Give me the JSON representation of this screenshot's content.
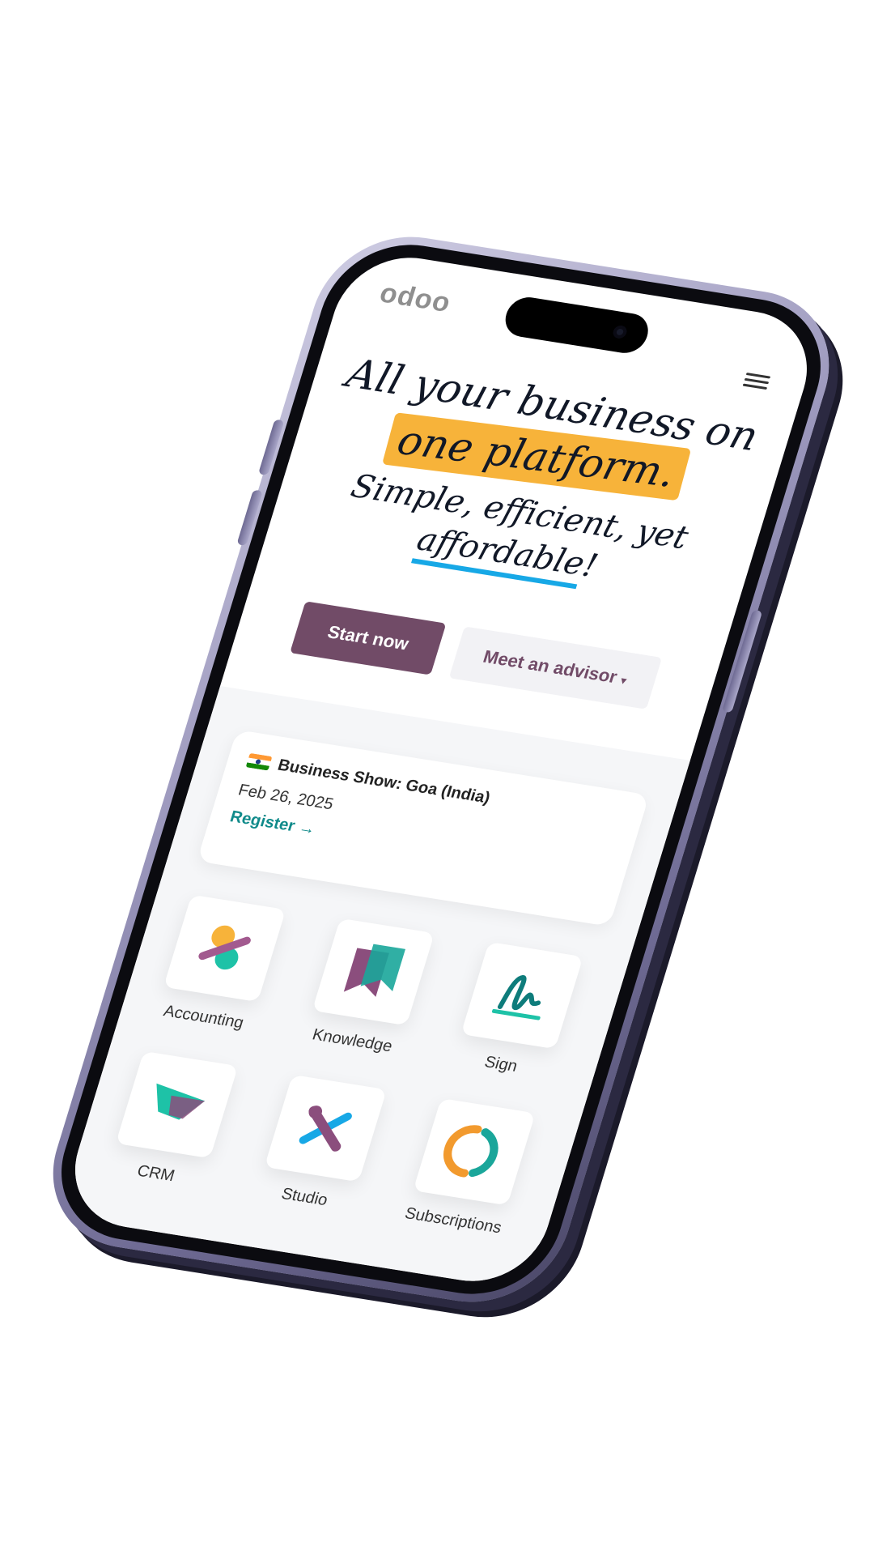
{
  "brand": {
    "logo_text": "odoo"
  },
  "hero": {
    "headline_line1": "All your business on",
    "headline_highlight": "one platform.",
    "subline_line1": "Simple, efficient, yet",
    "subline_underlined": "affordable",
    "subline_end": "!"
  },
  "cta": {
    "primary": "Start now",
    "secondary": "Meet an advisor"
  },
  "event": {
    "title": "Business Show: Goa (India)",
    "date": "Feb 26, 2025",
    "link": "Register →"
  },
  "apps": [
    {
      "label": "Accounting",
      "icon": "accounting-icon"
    },
    {
      "label": "Knowledge",
      "icon": "knowledge-icon"
    },
    {
      "label": "Sign",
      "icon": "sign-icon"
    },
    {
      "label": "CRM",
      "icon": "crm-icon"
    },
    {
      "label": "Studio",
      "icon": "studio-icon"
    },
    {
      "label": "Subscriptions",
      "icon": "subscriptions-icon"
    }
  ],
  "colors": {
    "brand_purple": "#714b67",
    "highlight_yellow": "#f7b33a",
    "underline_blue": "#17a8e6",
    "link_teal": "#0f8a8a"
  }
}
